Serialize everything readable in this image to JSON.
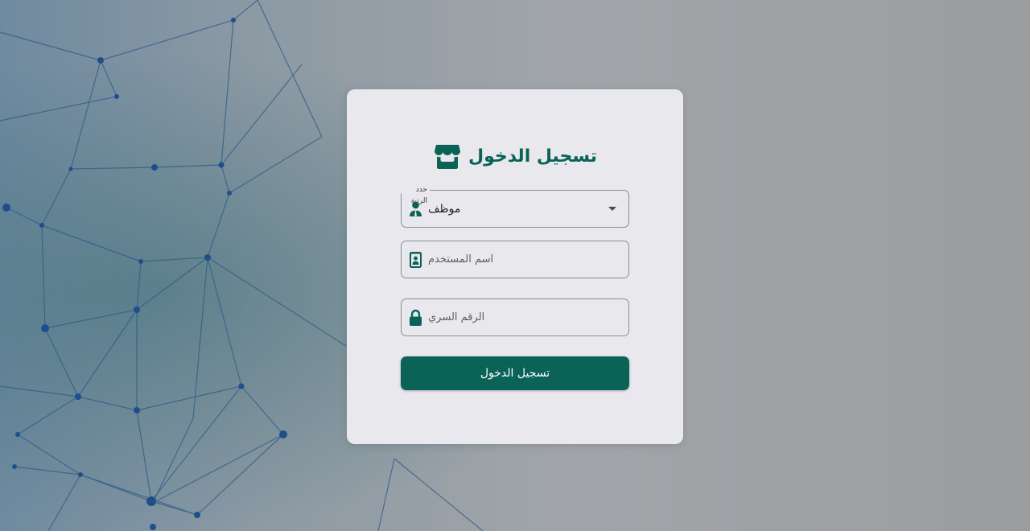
{
  "login": {
    "title": "تسجيل الدخول",
    "title_icon": "store-icon",
    "role_field": {
      "label": "حدد الرتبة",
      "selected_value": "موظف",
      "icon": "user-tie-icon"
    },
    "username_field": {
      "placeholder": "اسم المستخدم",
      "value": "",
      "icon": "id-badge-icon"
    },
    "password_field": {
      "placeholder": "الرقم السري",
      "value": "",
      "icon": "lock-icon"
    },
    "submit_label": "تسجيل الدخول"
  },
  "colors": {
    "accent": "#0b6358",
    "card_background": "#e8e8ed",
    "field_border": "#8d8f96"
  }
}
